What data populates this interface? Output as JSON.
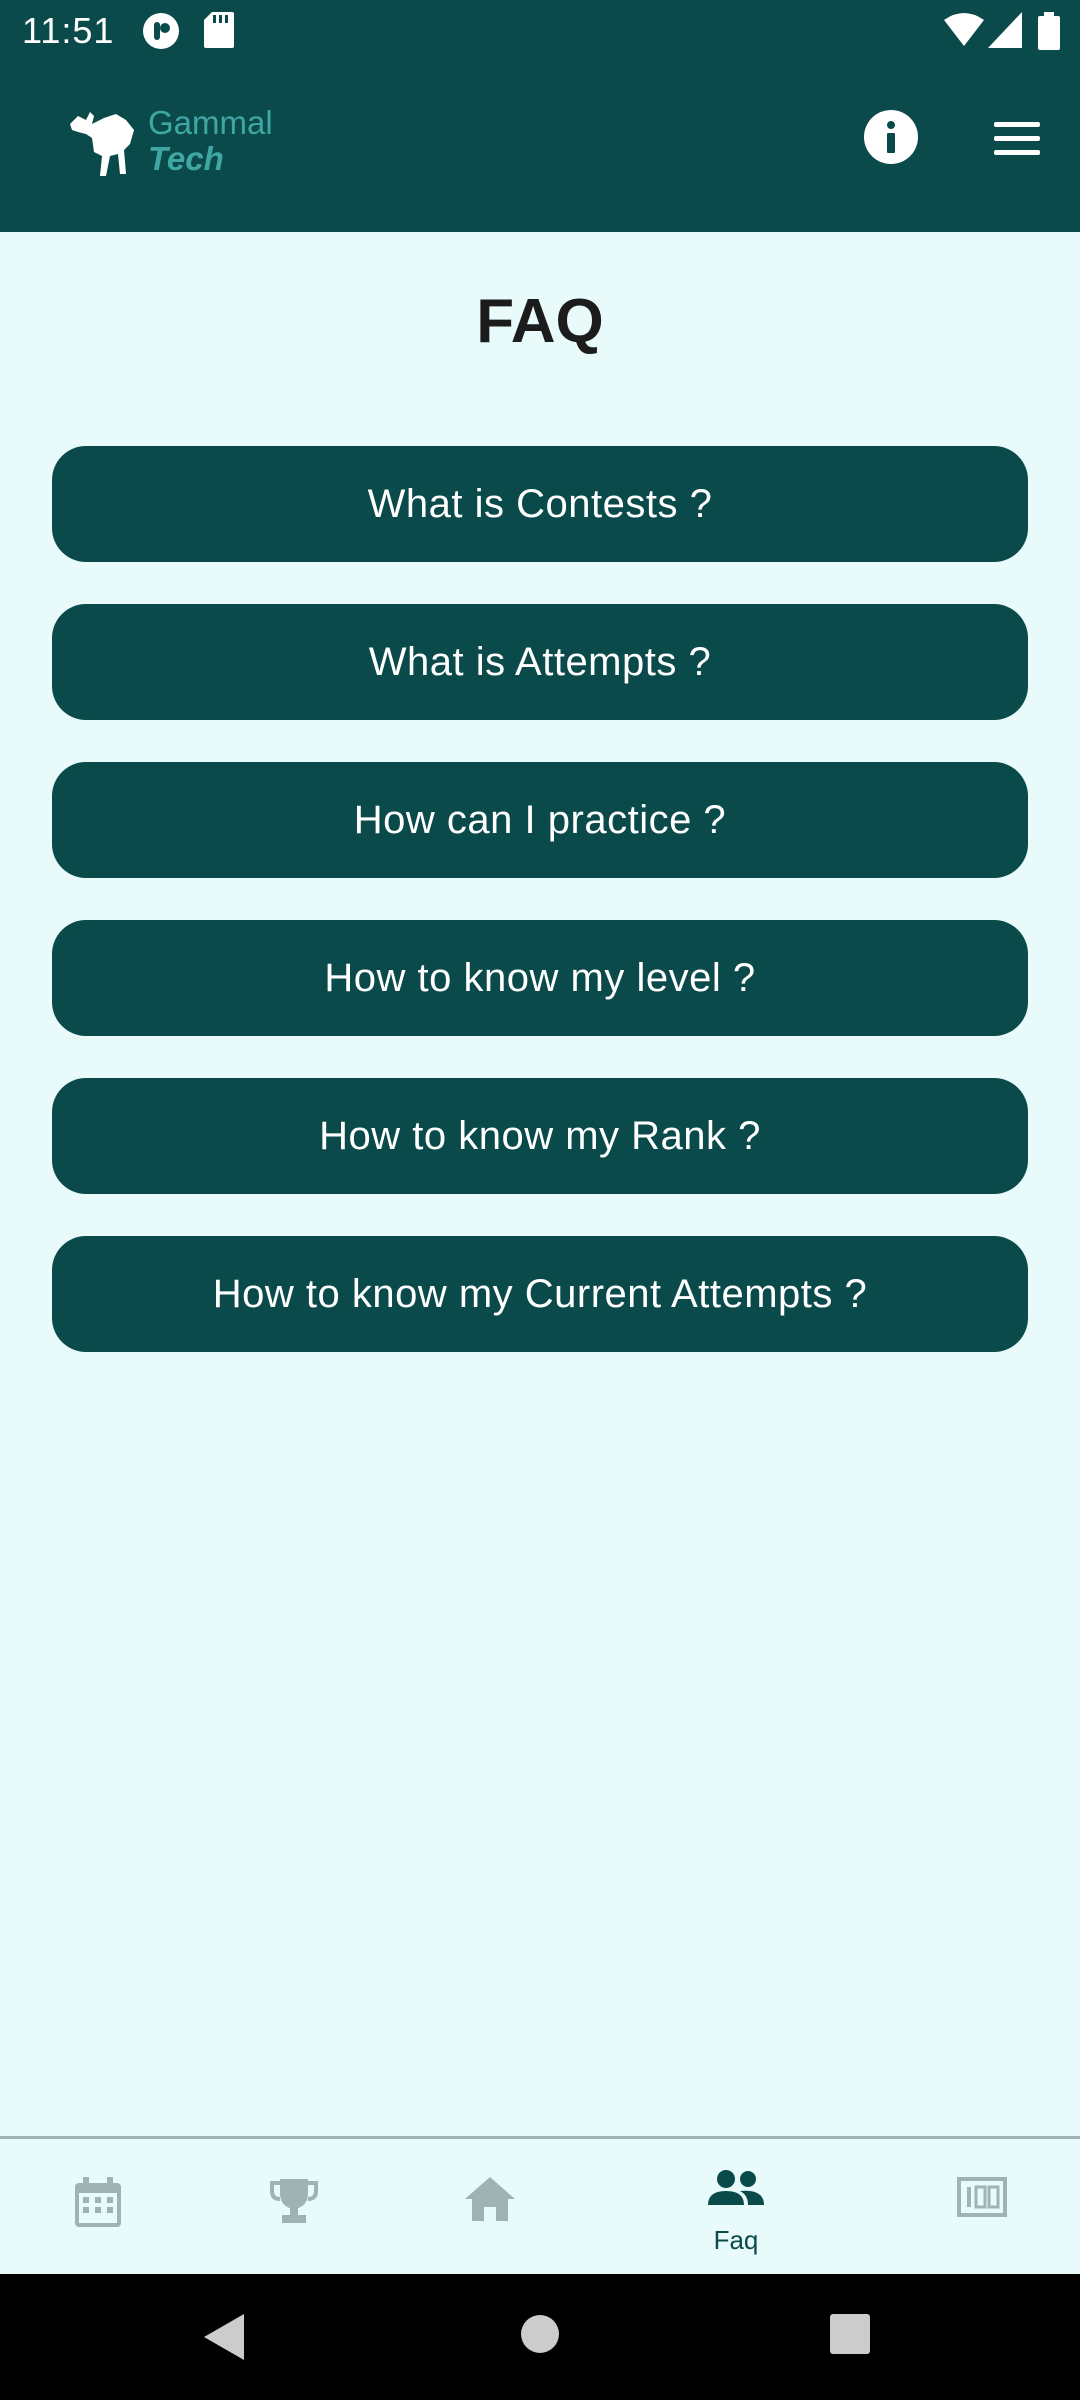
{
  "status_bar": {
    "time": "11:51",
    "icons_left": [
      "pocket-casts-icon",
      "sd-card-icon"
    ],
    "icons_right": [
      "wifi-icon",
      "cell-signal-icon",
      "battery-icon"
    ]
  },
  "app_bar": {
    "logo_line_1": "Gammal",
    "logo_line_2": "Tech",
    "info_icon": "info-icon",
    "menu_icon": "hamburger-menu-icon"
  },
  "page": {
    "title": "FAQ"
  },
  "faq_items": [
    {
      "label": "What is Contests ?"
    },
    {
      "label": "What is Attempts ?"
    },
    {
      "label": "How can I practice ?"
    },
    {
      "label": "How to know my level ?"
    },
    {
      "label": "How to know my Rank ?"
    },
    {
      "label": "How to know my Current Attempts ?"
    }
  ],
  "bottom_nav": {
    "items": [
      {
        "icon": "calendar-icon",
        "label": ""
      },
      {
        "icon": "trophy-icon",
        "label": ""
      },
      {
        "icon": "home-icon",
        "label": ""
      },
      {
        "icon": "people-icon",
        "label": "Faq",
        "active": true
      },
      {
        "icon": "scoreboard-icon",
        "label": ""
      }
    ]
  },
  "colors": {
    "primary": "#0b4a4a",
    "background": "#e8fafa",
    "inactive_icon": "#9fb3b3",
    "logo_accent": "#3fa7a3"
  }
}
